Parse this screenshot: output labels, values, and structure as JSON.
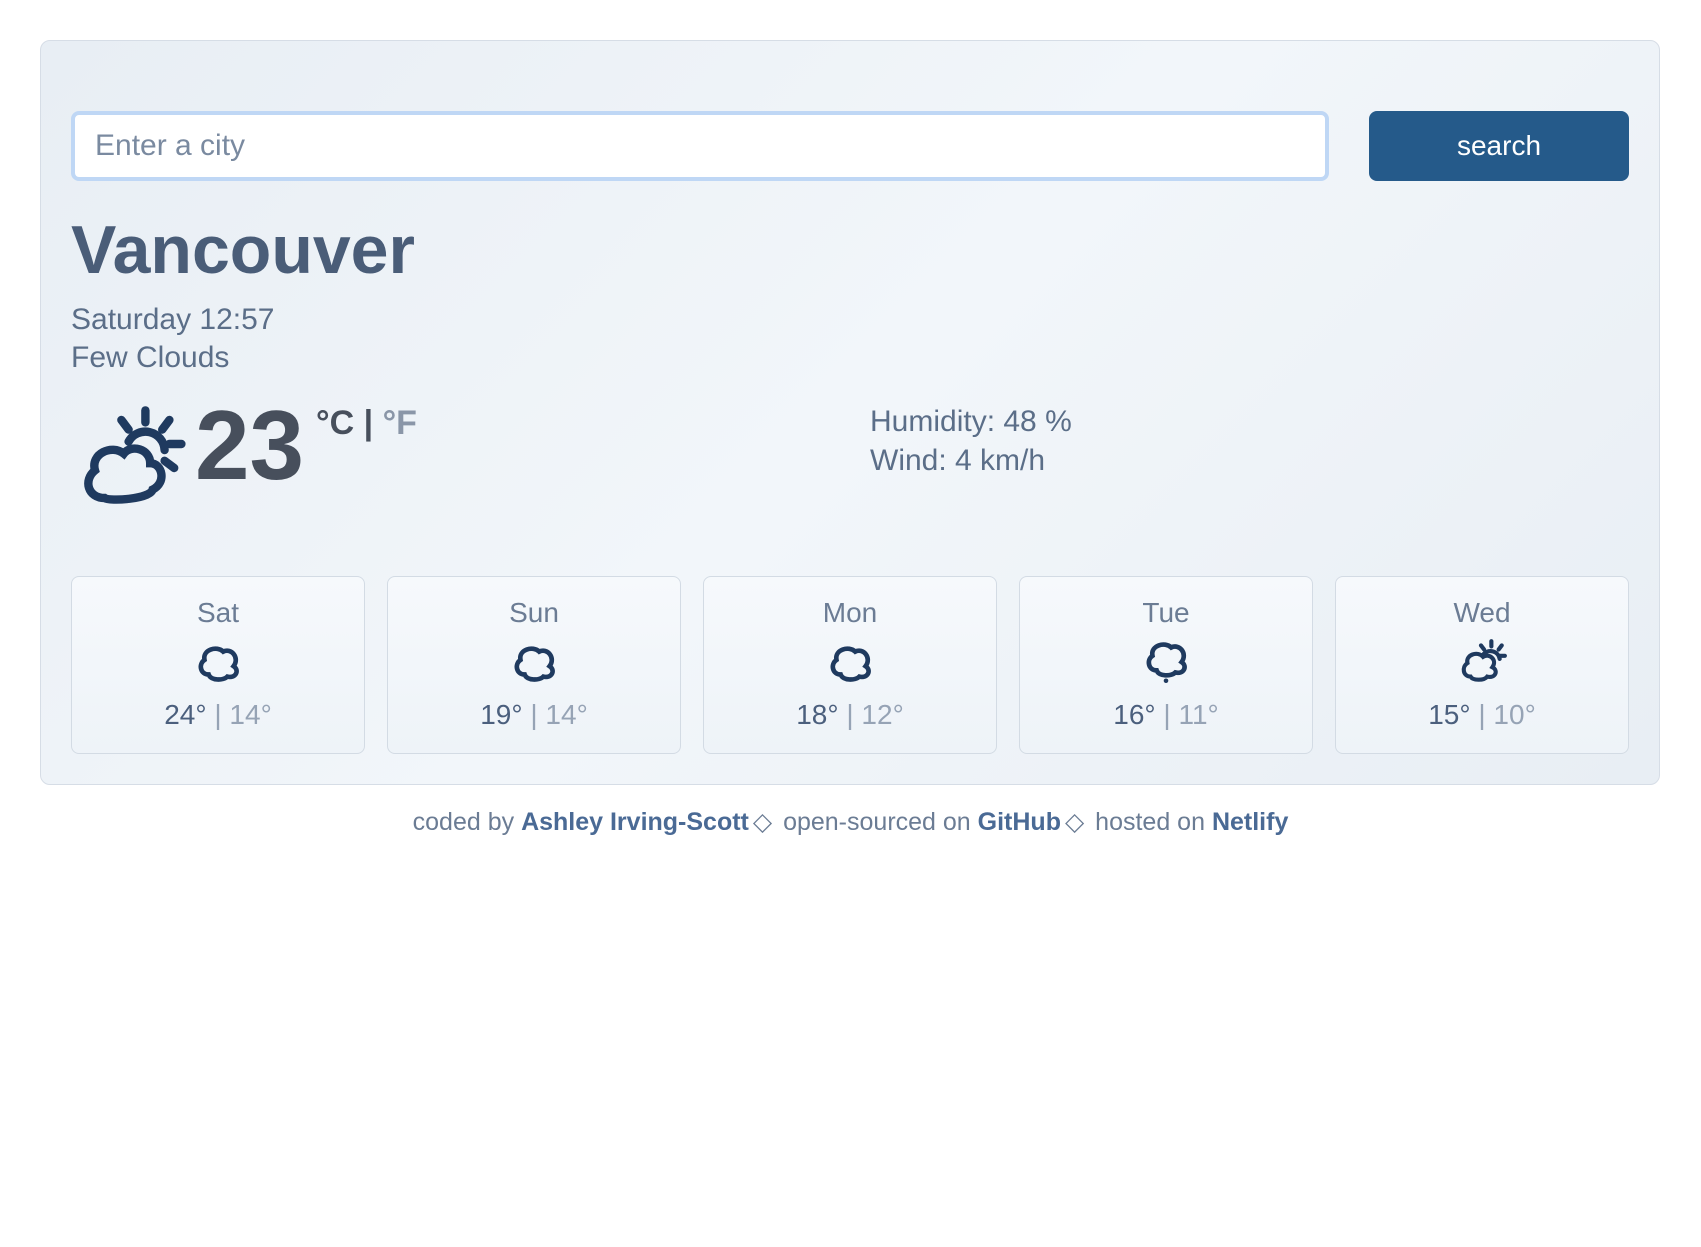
{
  "search": {
    "placeholder": "Enter a city",
    "button_label": "search"
  },
  "city": "Vancouver",
  "datetime": "Saturday 12:57",
  "condition": "Few Clouds",
  "temperature": "23",
  "units": {
    "c_label": "°C",
    "f_label": "°F",
    "separator": " | "
  },
  "details": {
    "humidity_label": "Humidity: ",
    "humidity_value": "48 %",
    "wind_label": "Wind: ",
    "wind_value": "4 km/h"
  },
  "forecast": [
    {
      "day": "Sat",
      "icon": "cloud",
      "high": "24°",
      "low": "14°"
    },
    {
      "day": "Sun",
      "icon": "cloud",
      "high": "19°",
      "low": "14°"
    },
    {
      "day": "Mon",
      "icon": "cloud",
      "high": "18°",
      "low": "12°"
    },
    {
      "day": "Tue",
      "icon": "rain",
      "high": "16°",
      "low": "11°"
    },
    {
      "day": "Wed",
      "icon": "partly",
      "high": "15°",
      "low": "10°"
    }
  ],
  "footer": {
    "coded_by_prefix": "coded by ",
    "author": "Ashley Irving-Scott",
    "open_sourced_prefix": " open-sourced on ",
    "github": "GitHub",
    "hosted_prefix": " hosted on ",
    "netlify": "Netlify"
  }
}
